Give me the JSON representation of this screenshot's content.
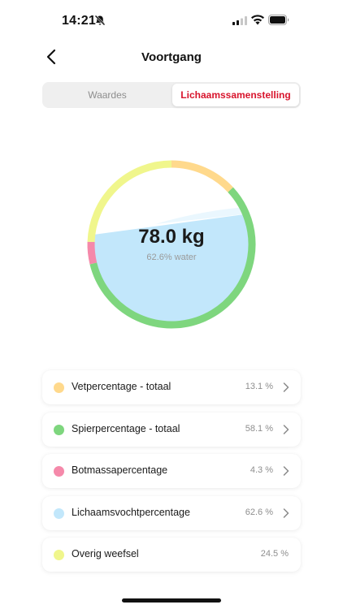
{
  "status": {
    "time": "14:21"
  },
  "nav": {
    "title": "Voortgang"
  },
  "segments": [
    {
      "label": "Waardes",
      "active": false
    },
    {
      "label": "Lichaamssamenstelling",
      "active": true
    }
  ],
  "summary": {
    "weight": "78.0 kg",
    "water": "62.6% water",
    "water_fraction": 0.626
  },
  "colors": {
    "accent": "#d8142c",
    "fat": "#ffd98c",
    "muscle": "#7ed67e",
    "bone": "#f589aa",
    "water": "#c2e7fb",
    "other": "#f0f68c"
  },
  "ring_segments": [
    {
      "key": "fat",
      "percent": 13.1
    },
    {
      "key": "muscle",
      "percent": 58.1
    },
    {
      "key": "bone",
      "percent": 4.3
    },
    {
      "key": "other",
      "percent": 24.5
    }
  ],
  "items": [
    {
      "label": "Vetpercentage - totaal",
      "value": "13.1 %",
      "color": "#ffd98c",
      "chevron": true
    },
    {
      "label": "Spierpercentage - totaal",
      "value": "58.1 %",
      "color": "#7ed67e",
      "chevron": true
    },
    {
      "label": "Botmassapercentage",
      "value": "4.3 %",
      "color": "#f589aa",
      "chevron": true
    },
    {
      "label": "Lichaamsvochtpercentage",
      "value": "62.6 %",
      "color": "#c2e7fb",
      "chevron": true
    },
    {
      "label": "Overig weefsel",
      "value": "24.5 %",
      "color": "#f0f68c",
      "chevron": false
    }
  ]
}
